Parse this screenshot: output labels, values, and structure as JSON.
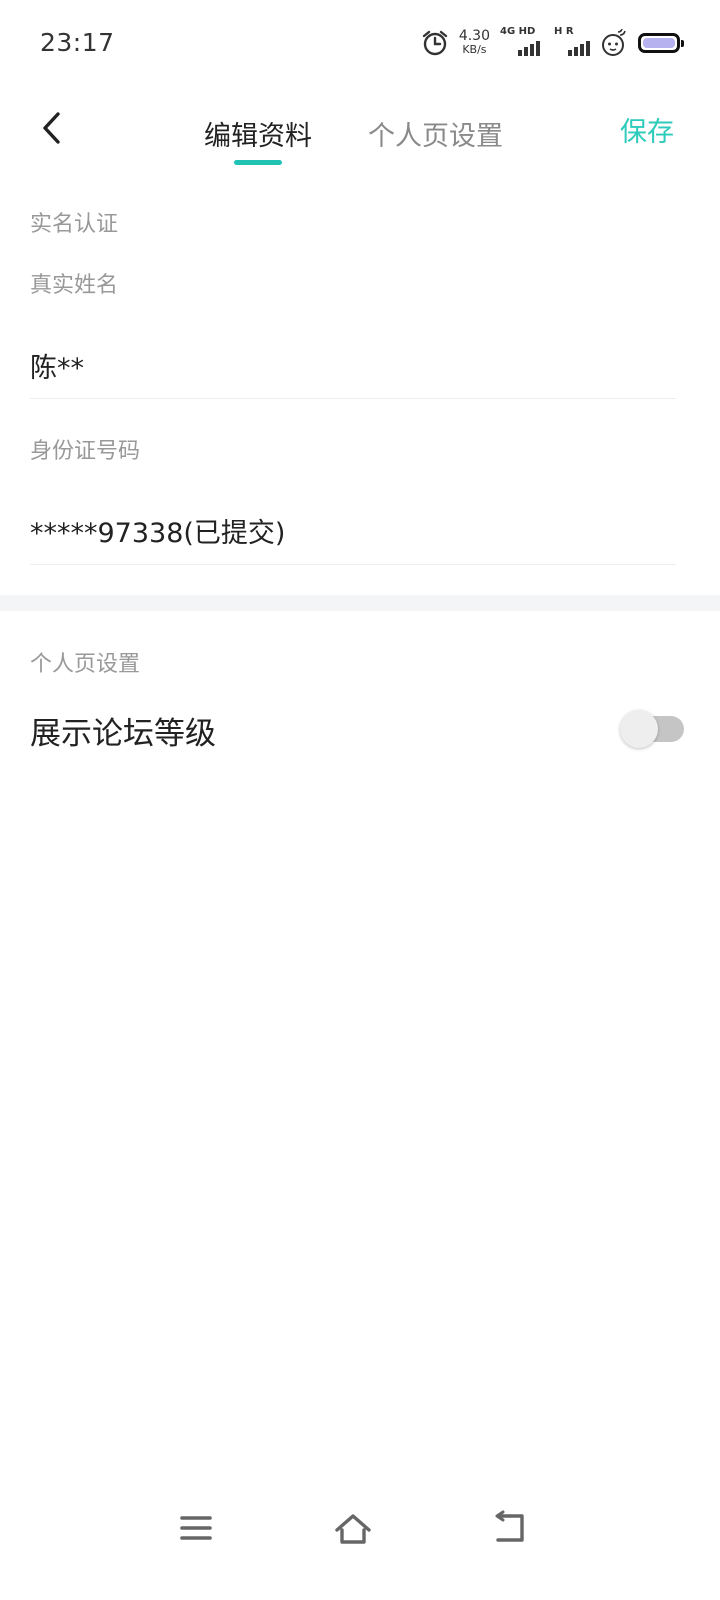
{
  "status_bar": {
    "time": "23:17",
    "net_speed_value": "4.30",
    "net_speed_unit": "KB/s",
    "sim1_label": "4G HD",
    "sim2_label": "H R",
    "icons": [
      "alarm-icon",
      "signal-icon",
      "signal-icon",
      "face-icon",
      "battery-icon"
    ],
    "battery_color": "#b6b2f0"
  },
  "header": {
    "back_icon": "chevron-left-icon",
    "tabs": [
      {
        "label": "编辑资料",
        "active": true
      },
      {
        "label": "个人页设置",
        "active": false
      }
    ],
    "save_label": "保存",
    "accent_color": "#20c3b3"
  },
  "realname": {
    "section_title": "实名认证",
    "name_label": "真实姓名",
    "name_value": "陈**",
    "id_label": "身份证号码",
    "id_value": "*****97338(已提交)"
  },
  "page_settings": {
    "section_title": "个人页设置",
    "toggle_label": "展示论坛等级",
    "toggle_on": false
  },
  "nav": {
    "icons": [
      "menu-icon",
      "home-icon",
      "back-icon"
    ]
  }
}
